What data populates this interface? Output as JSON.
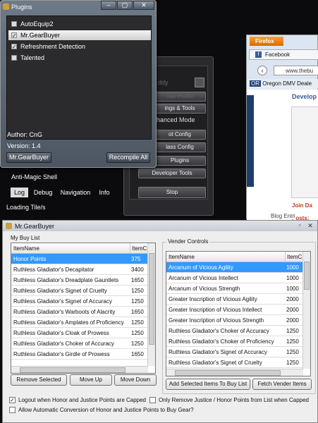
{
  "bot": {
    "top_label": "ddy",
    "load_profile": "oad Profile",
    "settings": "ings & Tools",
    "enhanced": "hanced Mode",
    "bot_config": "ot Config",
    "class_config": "lass Config",
    "plugins": "Plugins",
    "developer": "Developer Tools",
    "stop": "Stop",
    "anti_magic": "Anti-Magic Shell",
    "tabs": [
      "Log",
      "Debug",
      "Navigation",
      "Info"
    ],
    "status": "Loading Tile/s"
  },
  "plugins": {
    "title": "Plugins",
    "items": [
      {
        "name": "AutoEquip2",
        "checked": false
      },
      {
        "name": "Mr.GearBuyer",
        "checked": true
      },
      {
        "name": "Refreshment Detection",
        "checked": true
      },
      {
        "name": "Talented",
        "checked": false
      }
    ],
    "author": "Author:  CnG",
    "version": "Version: 1.4",
    "selected_button": "Mr.GearBuyer",
    "recompile": "Recompile All"
  },
  "firefox": {
    "menu": "Firefox",
    "tab": "Facebook",
    "url": "www.thebu",
    "bookmark": "Oregon DMV Deale",
    "heading": "Develop",
    "join": "Join Da",
    "posts": "Posts:",
    "blog": "Blog Entri"
  },
  "gearbuyer": {
    "title": "Mr.GearBuyer",
    "buy_list_label": "My Buy List",
    "vender_label": "Vender Controls",
    "col_name": "ItemName",
    "col_cost": "ItemC",
    "buy_list": [
      {
        "name": "Honor Points",
        "cost": "375"
      },
      {
        "name": "Ruthless Gladiator's Decapitator",
        "cost": "3400"
      },
      {
        "name": "Ruthless Gladiator's Dreadplate Gauntlets",
        "cost": "1650"
      },
      {
        "name": "Ruthless Gladiator's Signet of Cruelty",
        "cost": "1250"
      },
      {
        "name": "Ruthless Gladiator's Signet of Accuracy",
        "cost": "1250"
      },
      {
        "name": "Ruthless Gladiator's Warboots of Alacrity",
        "cost": "1650"
      },
      {
        "name": "Ruthless Gladiator's Amplates of Proficiency",
        "cost": "1250"
      },
      {
        "name": "Ruthless Gladiator's Cloak of Prowess",
        "cost": "1250"
      },
      {
        "name": "Ruthless Gladiator's Choker of Accuracy",
        "cost": "1250"
      },
      {
        "name": "Ruthless Gladiator's Girdle of Prowess",
        "cost": "1650"
      }
    ],
    "vender_list": [
      {
        "name": "Arcanum of Vicious Agility",
        "cost": "1000"
      },
      {
        "name": "Arcanum of Vicious Intellect",
        "cost": "1000"
      },
      {
        "name": "Arcanum of Vicious Strength",
        "cost": "1000"
      },
      {
        "name": "Greater Inscription of Vicious Agility",
        "cost": "2000"
      },
      {
        "name": "Greater Inscription of Vicious Intellect",
        "cost": "2000"
      },
      {
        "name": "Greater Inscription of Vicious Strength",
        "cost": "2000"
      },
      {
        "name": "Ruthless Gladiator's Choker of Accuracy",
        "cost": "1250"
      },
      {
        "name": "Ruthless Gladiator's Choker of Proficiency",
        "cost": "1250"
      },
      {
        "name": "Ruthless Gladiator's Signet of Accuracy",
        "cost": "1250"
      },
      {
        "name": "Ruthless Gladiator's Signet of Cruelty",
        "cost": "1250"
      }
    ],
    "remove_selected": "Remove Selected",
    "move_up": "Move Up",
    "move_down": "Move Down",
    "add_selected": "Add Selected Items To Buy List",
    "fetch": "Fetch Vender Items",
    "opt_logout": "Logout when Honor and Justice Points are Capped",
    "opt_logout_checked": true,
    "opt_remove": "Only Remove Justice / Honor Points from List when Capped",
    "opt_remove_checked": false,
    "opt_convert": "Allow Automatic Conversion of Honor and Justice Points to Buy Gear?",
    "opt_convert_checked": false
  }
}
